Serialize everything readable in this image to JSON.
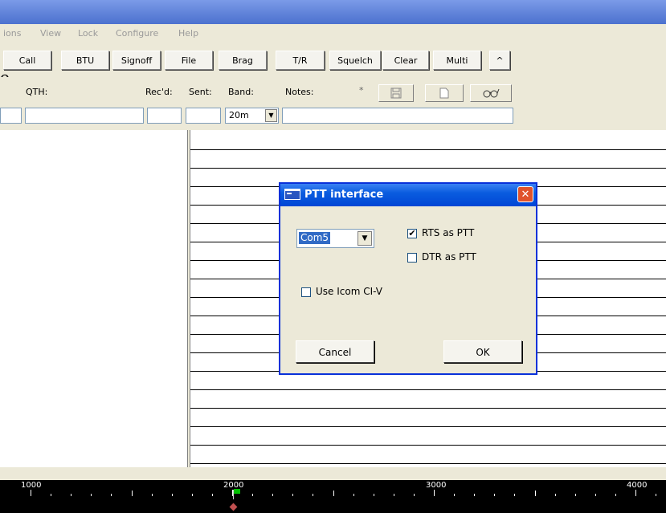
{
  "menu": [
    "ions",
    "View",
    "Lock",
    "Configure",
    "Help"
  ],
  "toolbar": {
    "buttons": [
      "Call",
      "BTU",
      "Signoff",
      "File",
      "Brag",
      "T/R",
      "Squelch",
      "Clear",
      "Multi",
      "^"
    ]
  },
  "edge_char": "e",
  "log": {
    "qth_label": "QTH:",
    "recd_label": "Rec'd:",
    "sent_label": "Sent:",
    "band_label": "Band:",
    "notes_label": "Notes:",
    "asterisk": "*",
    "band_value": "20m"
  },
  "dialog": {
    "title": "PTT interface",
    "port_value": "Com5",
    "rts_label": "RTS as PTT",
    "rts_checked": true,
    "dtr_label": "DTR as PTT",
    "dtr_checked": false,
    "icom_label": "Use Icom CI-V",
    "icom_checked": false,
    "cancel_label": "Cancel",
    "ok_label": "OK"
  },
  "ruler": {
    "labels": [
      "1000",
      "2000",
      "3000",
      "4000"
    ]
  },
  "colors": {
    "titlebar": "#5e81d8",
    "dialog_title": "#0a5cdf",
    "close_button": "#e0532c",
    "window_bg": "#ece9d8",
    "ruler_bg": "#000000",
    "marker_green": "#00c000"
  }
}
